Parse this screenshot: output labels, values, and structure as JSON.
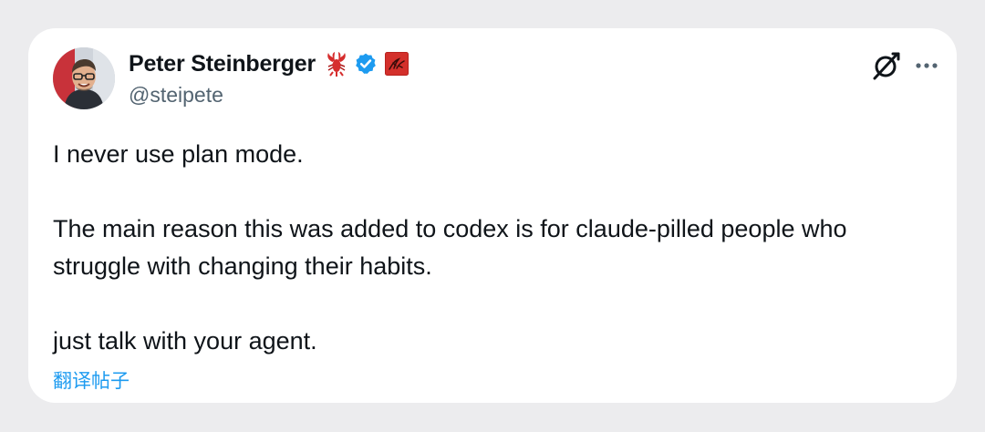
{
  "author": {
    "display_name": "Peter Steinberger",
    "handle": "@steipete",
    "emoji_icon": "lobster-emoji",
    "verified_icon": "verified-badge-icon",
    "affiliate_icon": "affiliate-badge-icon"
  },
  "tweet": {
    "paragraphs": [
      "I never use plan mode.",
      "The main reason this was added to codex is for claude-pilled people who struggle with changing their habits.",
      "just talk with your agent."
    ],
    "translate_label": "翻译帖子"
  },
  "actions": {
    "grok_icon": "grok-icon",
    "more_icon": "more-options-icon"
  },
  "colors": {
    "link": "#1d9bf0",
    "verified": "#1d9bf0",
    "text": "#0f1419",
    "secondary": "#536471",
    "card": "#ffffff",
    "background": "#ececee"
  }
}
